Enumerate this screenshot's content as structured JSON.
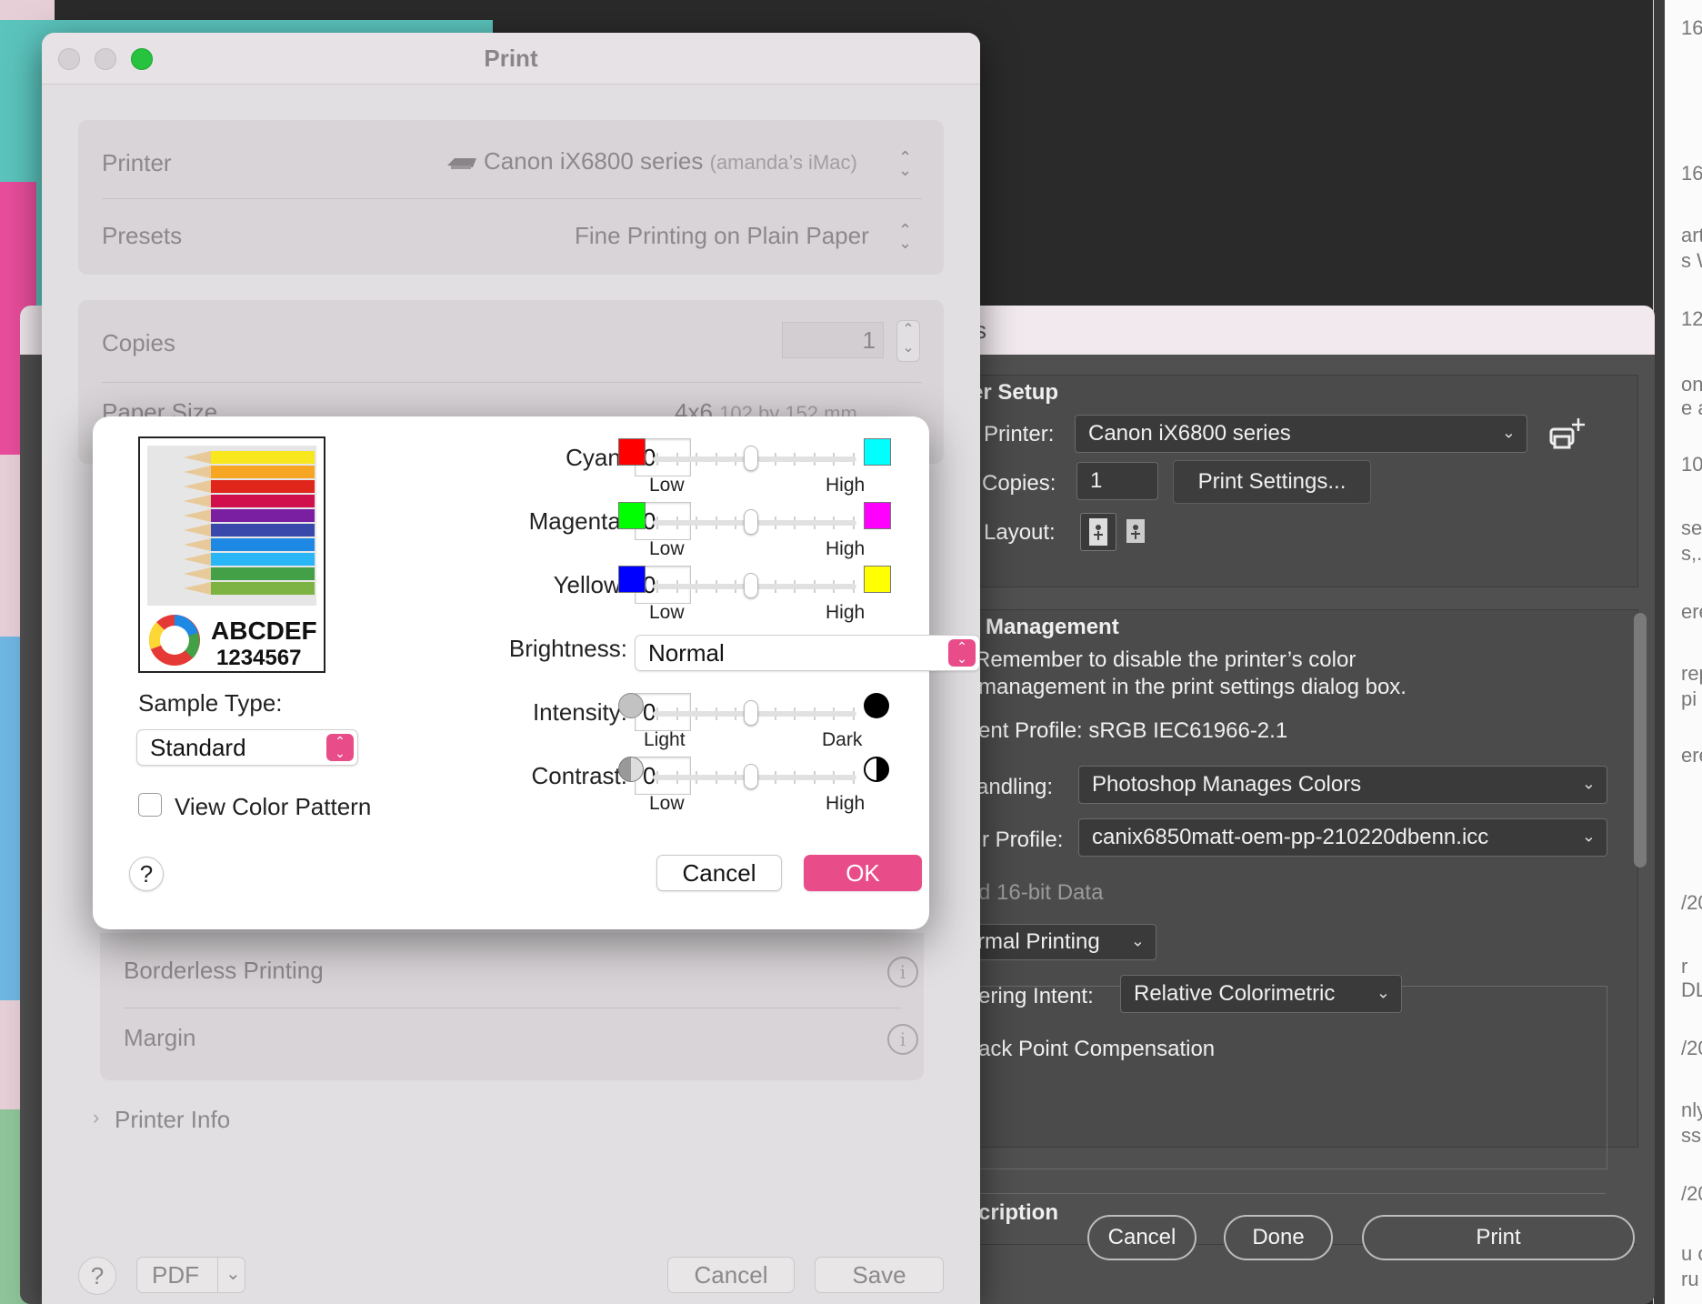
{
  "right_strip": {
    "fragments": [
      "16",
      "16",
      "art",
      "s W",
      "12",
      "on",
      "e a",
      "10",
      "se",
      "s,.",
      "ere",
      "rep",
      "pi",
      "ere",
      "/20",
      "r",
      "DL",
      "/20",
      "nly",
      "ss.",
      "/20",
      "u c",
      "ru"
    ]
  },
  "photoshop": {
    "title_fragment": "s",
    "section_setup": "er Setup",
    "printer_label": "Printer:",
    "printer_value": "Canon iX6800 series",
    "copies_label": "Copies:",
    "copies_value": "1",
    "print_settings_button": "Print Settings...",
    "layout_label": "Layout:",
    "color_management_heading": "Management",
    "reminder_line1": "Remember to disable the printer’s color",
    "reminder_line2": "management in the print settings dialog box.",
    "document_profile": "ent Profile: sRGB IEC61966-2.1",
    "handling_label": "andling:",
    "handling_value": "Photoshop Manages Colors",
    "profile_label": "r Profile:",
    "profile_value": "canix6850matt-oem-pp-210220dbenn.icc",
    "sixteen_bit": "d 16-bit Data",
    "normal_printing": "rmal Printing",
    "rendering_intent_label": "ering Intent:",
    "rendering_intent_value": "Relative Colorimetric",
    "black_point": "ack Point Compensation",
    "description_heading": "cription",
    "cancel": "Cancel",
    "done": "Done",
    "print": "Print"
  },
  "mac_print": {
    "title": "Print",
    "printer_label": "Printer",
    "printer_value": "Canon iX6800 series",
    "printer_host": "(amanda’s iMac)",
    "presets_label": "Presets",
    "presets_value": "Fine Printing on Plain Paper",
    "copies_label": "Copies",
    "copies_value": "1",
    "paper_size_label": "Paper Size",
    "paper_size_value": "4x6",
    "paper_size_dims": "102 by 152 mm",
    "borderless_label": "Borderless Printing",
    "margin_label": "Margin",
    "printer_info": "Printer Info",
    "help": "?",
    "pdf": "PDF",
    "cancel": "Cancel",
    "save": "Save"
  },
  "color_modal": {
    "sample_text1": "ABCDEF",
    "sample_text2": "1234567",
    "sample_type_label": "Sample Type:",
    "sample_type_value": "Standard",
    "view_color_pattern": "View Color Pattern",
    "cyan_label": "Cyan:",
    "cyan_value": "0",
    "magenta_label": "Magenta:",
    "magenta_value": "0",
    "yellow_label": "Yellow:",
    "yellow_value": "0",
    "brightness_label": "Brightness:",
    "brightness_value": "Normal",
    "intensity_label": "Intensity:",
    "intensity_value": "0",
    "contrast_label": "Contrast:",
    "contrast_value": "0",
    "low": "Low",
    "high": "High",
    "light": "Light",
    "dark": "Dark",
    "help": "?",
    "cancel": "Cancel",
    "ok": "OK",
    "colors": {
      "red": "#ff0000",
      "cyan": "#00ffff",
      "green": "#00ff00",
      "magenta": "#ff00ff",
      "blue": "#0000ff",
      "yellow": "#ffff00",
      "accent": "#e84d8a"
    }
  }
}
